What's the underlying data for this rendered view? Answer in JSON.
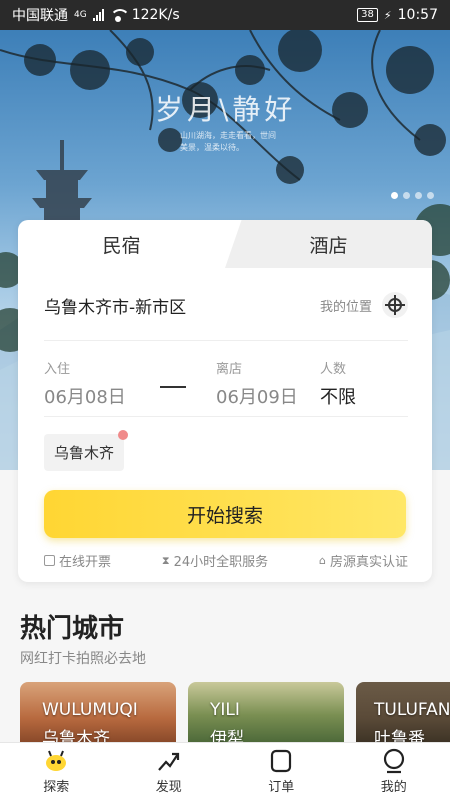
{
  "status_bar": {
    "carrier": "中国联通",
    "network": "4G",
    "speed": "122K/s",
    "battery": "38",
    "time": "10:57"
  },
  "hero": {
    "title": "岁月\\静好",
    "subtitle": "山川湖海，走走看看，世间美景，温柔以待。",
    "dots_total": 4,
    "dots_active": 1
  },
  "booking": {
    "tabs": [
      "民宿",
      "酒店"
    ],
    "active_tab": "民宿",
    "location": "乌鲁木齐市-新市区",
    "my_location_label": "我的位置",
    "checkin_label": "入住",
    "checkin_date": "06月08日",
    "checkout_label": "离店",
    "checkout_date": "06月09日",
    "guests_label": "人数",
    "guests_value": "不限",
    "history_chip": "乌鲁木齐",
    "search_button": "开始搜索",
    "features": [
      "在线开票",
      "24小时全职服务",
      "房源真实认证"
    ]
  },
  "hot_cities": {
    "title": "热门城市",
    "subtitle": "网红打卡拍照必去地",
    "cities": [
      {
        "en": "WULUMUQI",
        "cn": "乌鲁木齐"
      },
      {
        "en": "YILI",
        "cn": "伊犁"
      },
      {
        "en": "TULUFAN",
        "cn": "吐鲁番"
      }
    ]
  },
  "nav": {
    "items": [
      "探索",
      "发现",
      "订单",
      "我的"
    ],
    "active": "探索"
  },
  "colors": {
    "accent": "#ffd633",
    "text": "#222222",
    "muted": "#888888"
  }
}
